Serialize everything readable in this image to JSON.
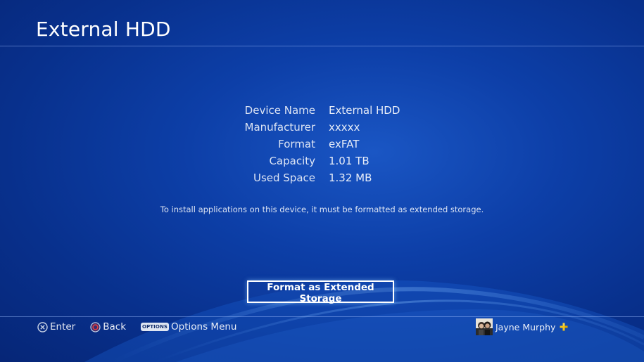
{
  "header": {
    "title": "External HDD"
  },
  "device_info": [
    {
      "label": "Device Name",
      "value": "External HDD"
    },
    {
      "label": "Manufacturer",
      "value": "xxxxx"
    },
    {
      "label": "Format",
      "value": "exFAT"
    },
    {
      "label": "Capacity",
      "value": "1.01 TB"
    },
    {
      "label": "Used Space",
      "value": "1.32 MB"
    }
  ],
  "notice": "To install applications on this device, it must be formatted as extended storage.",
  "actions": {
    "format_button": "Format as Extended Storage"
  },
  "hints": {
    "enter": {
      "icon": "cross-button-icon",
      "label": "Enter"
    },
    "back": {
      "icon": "circle-button-icon",
      "label": "Back"
    },
    "options": {
      "icon": "options-button-icon",
      "badge": "OPTIONS",
      "label": "Options Menu"
    }
  },
  "user": {
    "name": "Jayne Murphy",
    "plus_icon": "playstation-plus-icon"
  },
  "colors": {
    "background": "#0d3fa8",
    "plus": "#f5c518",
    "back_button": "#e0403f"
  }
}
